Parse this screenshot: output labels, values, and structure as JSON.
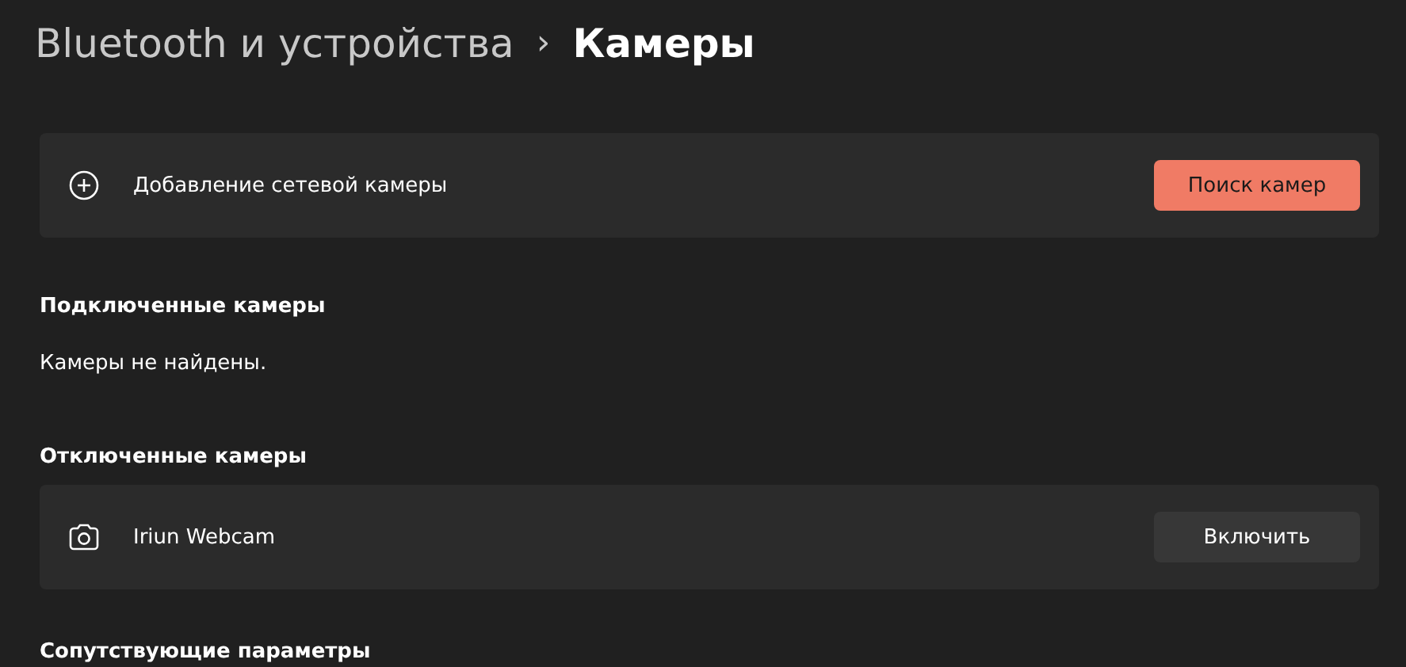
{
  "breadcrumb": {
    "parent": "Bluetooth и устройства",
    "separator": "›",
    "current": "Камеры"
  },
  "add_card": {
    "label": "Добавление сетевой камеры",
    "button": "Поиск камер"
  },
  "connected": {
    "heading": "Подключенные камеры",
    "message": "Камеры не найдены."
  },
  "disabled": {
    "heading": "Отключенные камеры",
    "cameras": [
      {
        "name": "Iriun Webcam",
        "button": "Включить"
      }
    ]
  },
  "related": {
    "heading": "Сопутствующие параметры"
  }
}
